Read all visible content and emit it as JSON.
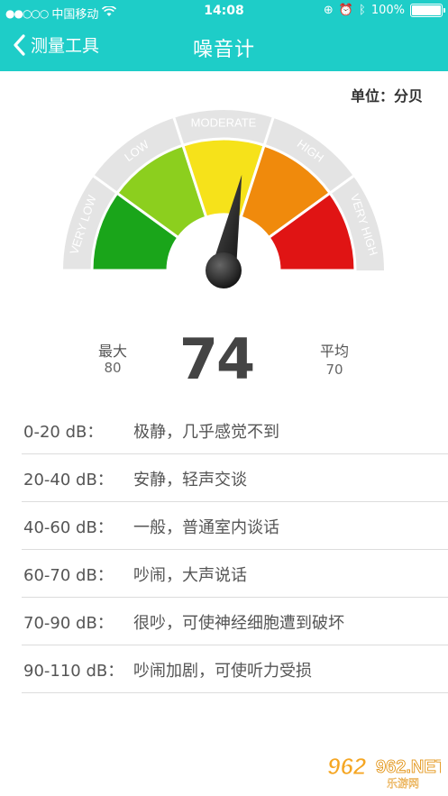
{
  "status_bar": {
    "carrier": "中国移动",
    "time": "14:08",
    "battery": "100%"
  },
  "nav": {
    "back_label": "测量工具",
    "title": "噪音计"
  },
  "unit_label": "单位：分贝",
  "gauge": {
    "labels": [
      "VERY LOW",
      "LOW",
      "MODERATE",
      "HIGH",
      "VERY HIGH"
    ],
    "colors": [
      "#1aa51a",
      "#8ccf1e",
      "#f6e21a",
      "#f08a0c",
      "#e01414"
    ],
    "needle_fraction": 0.56
  },
  "readings": {
    "max_label": "最大",
    "max_value": "80",
    "current_value": "74",
    "avg_label": "平均",
    "avg_value": "70"
  },
  "levels": [
    {
      "range": "0-20 dB：",
      "desc": "极静，几乎感觉不到"
    },
    {
      "range": "20-40 dB：",
      "desc": "安静，轻声交谈"
    },
    {
      "range": "40-60 dB：",
      "desc": "一般，普通室内谈话"
    },
    {
      "range": "60-70 dB：",
      "desc": "吵闹，大声说话"
    },
    {
      "range": "70-90 dB：",
      "desc": "很吵，可使神经细胞遭到破坏"
    },
    {
      "range": "90-110 dB：",
      "desc": "吵闹加剧，可使听力受损"
    }
  ],
  "watermark": {
    "logo": "962.NET",
    "sub": "乐游网"
  }
}
